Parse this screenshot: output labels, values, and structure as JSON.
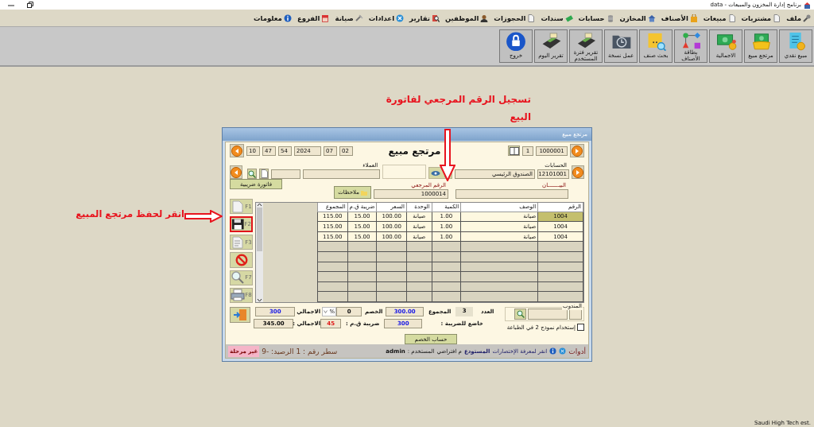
{
  "window": {
    "title": "برنامج إدارة المخزون والمبيعات - data"
  },
  "menu": [
    "ملف",
    "مشتريات",
    "مبيعات",
    "الأصناف",
    "المخازن",
    "حسابات",
    "سندات",
    "الحجوزات",
    "الموظفين",
    "تقارير",
    "اعدادات",
    "صيانة",
    "الفروع",
    "معلومات"
  ],
  "toolbar": [
    "مبيع نقدي",
    "مرتجع مبيع",
    "الاجمالية",
    "بطاقة الأصناف",
    "بحث صنف",
    "عمل نسخة",
    "تقرير فترة المستخدم",
    "تقرير اليوم",
    "خروج"
  ],
  "annotations": [
    {
      "kind": "down",
      "text": "تسجيل الرقم المرجعي لفاتورة البيع"
    },
    {
      "kind": "right",
      "text": "انقر لحفظ مرتجع المبيع"
    }
  ],
  "dialog": {
    "title": "مرتجع مبيع",
    "heading": "مرتجع مبيع",
    "invoice_number": "1000001",
    "copy_number": "1",
    "date": [
      "02",
      "07",
      "2024"
    ],
    "time": [
      "54",
      "47",
      "10"
    ],
    "account": {
      "label": "الحسابات",
      "code": "12101001",
      "name": "الصندوق الرئيسي"
    },
    "customer": {
      "label": "العملاء"
    },
    "statement": {
      "label": "البيـــــــان"
    },
    "reference": {
      "label": "الرقم المرجعي",
      "value": "1000014"
    },
    "notes_button": "ملاحظات",
    "tax_invoice_button": "فاتورة ضريبية",
    "side_buttons": [
      {
        "kind": "new",
        "key": "F1",
        "highlighted": false
      },
      {
        "kind": "save",
        "key": "F2",
        "highlighted": true
      },
      {
        "kind": "edit",
        "key": "F3",
        "highlighted": false
      },
      {
        "kind": "cancel",
        "highlighted": false
      },
      {
        "kind": "search",
        "key": "F7",
        "highlighted": false
      },
      {
        "kind": "print",
        "key": "F8",
        "highlighted": false
      }
    ],
    "table": {
      "columns": [
        "الرقم",
        "الوصف",
        "الكمية",
        "الوحدة",
        "السعر",
        "ضريبة ق.م",
        "المجموع"
      ],
      "rows": [
        {
          "cells": [
            "1004",
            "صيانة",
            "1.00",
            "صيانة",
            "100.00",
            "15.00",
            "115.00"
          ],
          "selected": true
        },
        {
          "cells": [
            "1004",
            "صيانة",
            "1.00",
            "صيانة",
            "100.00",
            "15.00",
            "115.00"
          ],
          "selected": false
        },
        {
          "cells": [
            "1004",
            "صيانة",
            "1.00",
            "صيانة",
            "100.00",
            "15.00",
            "115.00"
          ],
          "selected": false
        }
      ]
    },
    "summary": {
      "salesman_label": "المندوب",
      "print_option": {
        "label": "إستخدام نموذج 2 في الطباعة",
        "checked": false
      },
      "count_label": "العدد",
      "count": "3",
      "subtotal_label": "المجموع",
      "subtotal": "300.00",
      "discount_label": "الخصم",
      "discount": "0",
      "discount_unit": "%",
      "total_label": "الاجمالي",
      "total": "300",
      "taxable_label": "خاضع للضريبة :",
      "taxable": "300",
      "vat_label": "ضريبة ق.م :",
      "vat": "45",
      "grand_total_label": "الاجمالي :",
      "grand_total": "345.00"
    },
    "discount_button": "حساب الخصم",
    "status_bar": {
      "tools": "أدوات",
      "shortcuts_hint": "انقر لمعرفة الإختصارات",
      "warehouse_label": "المستودع",
      "warehouse": "م افتراضي",
      "user_label": "المستخدم :",
      "user": "admin",
      "line": "سطر رقم : 1",
      "balance": "الرصيد: -9",
      "posting_status": "غير مرحلة"
    }
  },
  "footer": "Saudi High Tech est."
}
